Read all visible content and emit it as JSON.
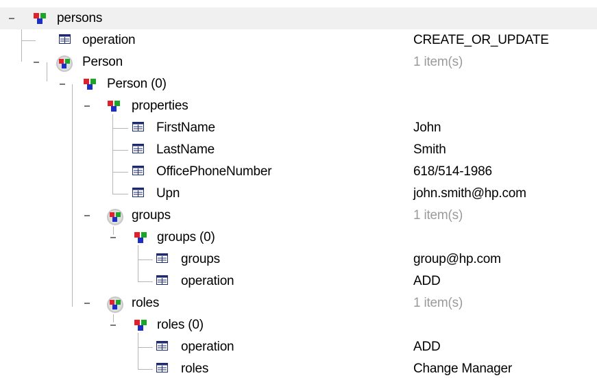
{
  "tree": {
    "persons": {
      "label": "persons",
      "icon": "record-icon"
    },
    "operation_top": {
      "label": "operation",
      "value": "CREATE_OR_UPDATE",
      "icon": "field-icon"
    },
    "person": {
      "label": "Person",
      "value": "1 item(s)",
      "icon": "collection-icon"
    },
    "person_0": {
      "label": "Person (0)",
      "icon": "record-icon"
    },
    "properties": {
      "label": "properties",
      "icon": "record-icon"
    },
    "first_name": {
      "label": "FirstName",
      "value": "John",
      "icon": "field-icon"
    },
    "last_name": {
      "label": "LastName",
      "value": "Smith",
      "icon": "field-icon"
    },
    "office_phone": {
      "label": "OfficePhoneNumber",
      "value": "618/514-1986",
      "icon": "field-icon"
    },
    "upn": {
      "label": "Upn",
      "value": "john.smith@hp.com",
      "icon": "field-icon"
    },
    "groups": {
      "label": "groups",
      "value": "1 item(s)",
      "icon": "collection-icon"
    },
    "groups_0": {
      "label": "groups (0)",
      "icon": "record-icon"
    },
    "groups_field": {
      "label": "groups",
      "value": "group@hp.com",
      "icon": "field-icon"
    },
    "groups_operation": {
      "label": "operation",
      "value": "ADD",
      "icon": "field-icon"
    },
    "roles": {
      "label": "roles",
      "value": "1 item(s)",
      "icon": "collection-icon"
    },
    "roles_0": {
      "label": "roles (0)",
      "icon": "record-icon"
    },
    "roles_operation": {
      "label": "operation",
      "value": "ADD",
      "icon": "field-icon"
    },
    "roles_field": {
      "label": "roles",
      "value": "Change Manager",
      "icon": "field-icon"
    }
  },
  "colors": {
    "selected_row": "#f0f0f0",
    "muted_value": "#9a9a9a",
    "tree_line": "#b5b5b5",
    "record_red": "#e0202a",
    "record_green": "#1ea428",
    "record_blue": "#1b2ec8",
    "field_navy": "#1c2a6e"
  }
}
